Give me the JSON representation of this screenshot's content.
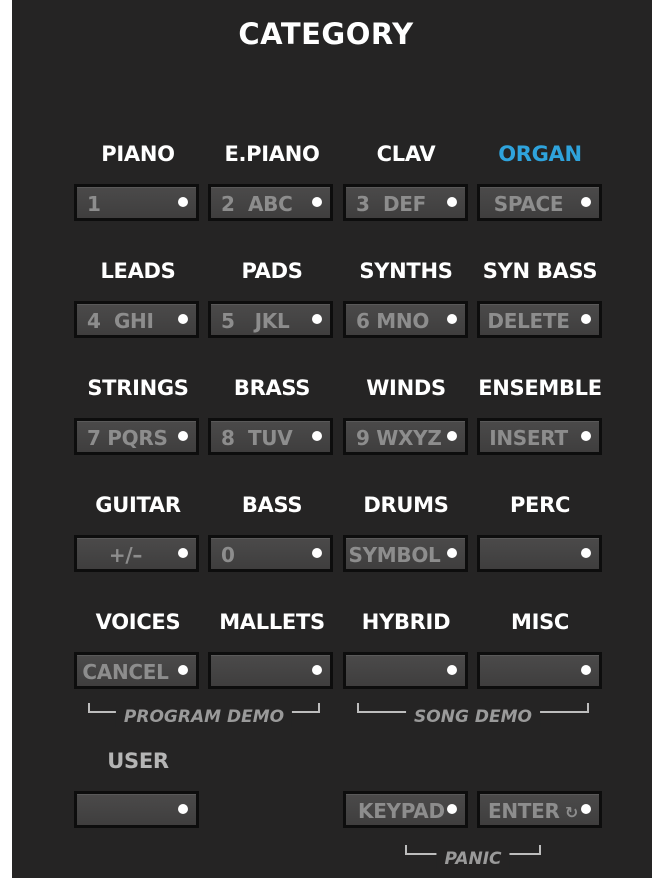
{
  "title": "CATEGORY",
  "rows": [
    [
      {
        "label": "PIANO",
        "key": "1"
      },
      {
        "label": "E.PIANO",
        "key": "2  ABC"
      },
      {
        "label": "CLAV",
        "key": "3  DEF"
      },
      {
        "label": "ORGAN",
        "key": "SPACE",
        "active": true
      }
    ],
    [
      {
        "label": "LEADS",
        "key": "4  GHI"
      },
      {
        "label": "PADS",
        "key": "5   JKL"
      },
      {
        "label": "SYNTHS",
        "key": "6 MNO"
      },
      {
        "label": "SYN BASS",
        "key": "DELETE"
      }
    ],
    [
      {
        "label": "STRINGS",
        "key": "7 PQRS"
      },
      {
        "label": "BRASS",
        "key": "8  TUV"
      },
      {
        "label": "WINDS",
        "key": "9 WXYZ"
      },
      {
        "label": "ENSEMBLE",
        "key": "INSERT"
      }
    ],
    [
      {
        "label": "GUITAR",
        "key": "+/–"
      },
      {
        "label": "BASS",
        "key": "0"
      },
      {
        "label": "DRUMS",
        "key": "SYMBOL"
      },
      {
        "label": "PERC",
        "key": ""
      }
    ],
    [
      {
        "label": "VOICES",
        "key": "CANCEL"
      },
      {
        "label": "MALLETS",
        "key": ""
      },
      {
        "label": "HYBRID",
        "key": ""
      },
      {
        "label": "MISC",
        "key": ""
      }
    ]
  ],
  "demo": {
    "program": "PROGRAM DEMO",
    "song": "SONG DEMO"
  },
  "user": {
    "label": "USER",
    "key": ""
  },
  "bottom": {
    "keypad": "KEYPAD",
    "enter": "ENTER",
    "enter_icon": "refresh-icon",
    "panic": "PANIC"
  },
  "colors": {
    "panel": "#252424",
    "active": "#2fa3dc",
    "led": "#ffffff"
  }
}
